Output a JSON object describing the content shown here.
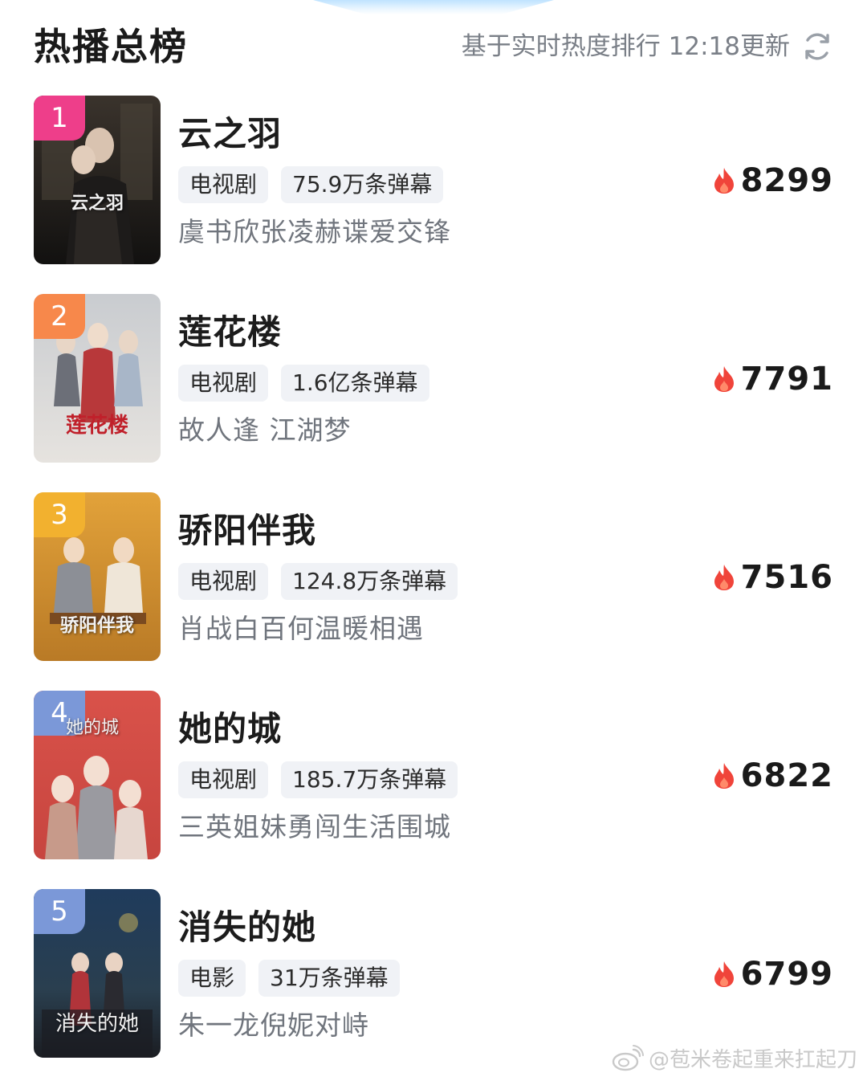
{
  "header": {
    "title": "热播总榜",
    "subtitle": "基于实时热度排行 12:18更新"
  },
  "items": [
    {
      "rank": "1",
      "rank_color": "#ee3e8a",
      "name": "云之羽",
      "type": "电视剧",
      "danmu": "75.9万条弹幕",
      "desc": "虞书欣张凌赫谍爱交锋",
      "heat": "8299",
      "poster_title": "云之羽"
    },
    {
      "rank": "2",
      "rank_color": "#f7884b",
      "name": "莲花楼",
      "type": "电视剧",
      "danmu": "1.6亿条弹幕",
      "desc": "故人逢 江湖梦",
      "heat": "7791",
      "poster_title": "莲花楼"
    },
    {
      "rank": "3",
      "rank_color": "#f2b12f",
      "name": "骄阳伴我",
      "type": "电视剧",
      "danmu": "124.8万条弹幕",
      "desc": "肖战白百何温暖相遇",
      "heat": "7516",
      "poster_title": "骄阳伴我"
    },
    {
      "rank": "4",
      "rank_color": "#7b98d8",
      "name": "她的城",
      "type": "电视剧",
      "danmu": "185.7万条弹幕",
      "desc": "三英姐妹勇闯生活围城",
      "heat": "6822",
      "poster_title": "她的城"
    },
    {
      "rank": "5",
      "rank_color": "#7b98d8",
      "name": "消失的她",
      "type": "电影",
      "danmu": "31万条弹幕",
      "desc": "朱一龙倪妮对峙",
      "heat": "6799",
      "poster_title": "消失的她"
    }
  ],
  "watermark": "@苞米卷起重来扛起刀",
  "icons": {
    "refresh": "refresh-icon",
    "heat": "flame-icon",
    "watermark": "weibo-logo-icon"
  },
  "colors": {
    "flame": "#f0443a",
    "tag_bg": "#f0f2f6",
    "subtitle": "#7a7f87"
  }
}
